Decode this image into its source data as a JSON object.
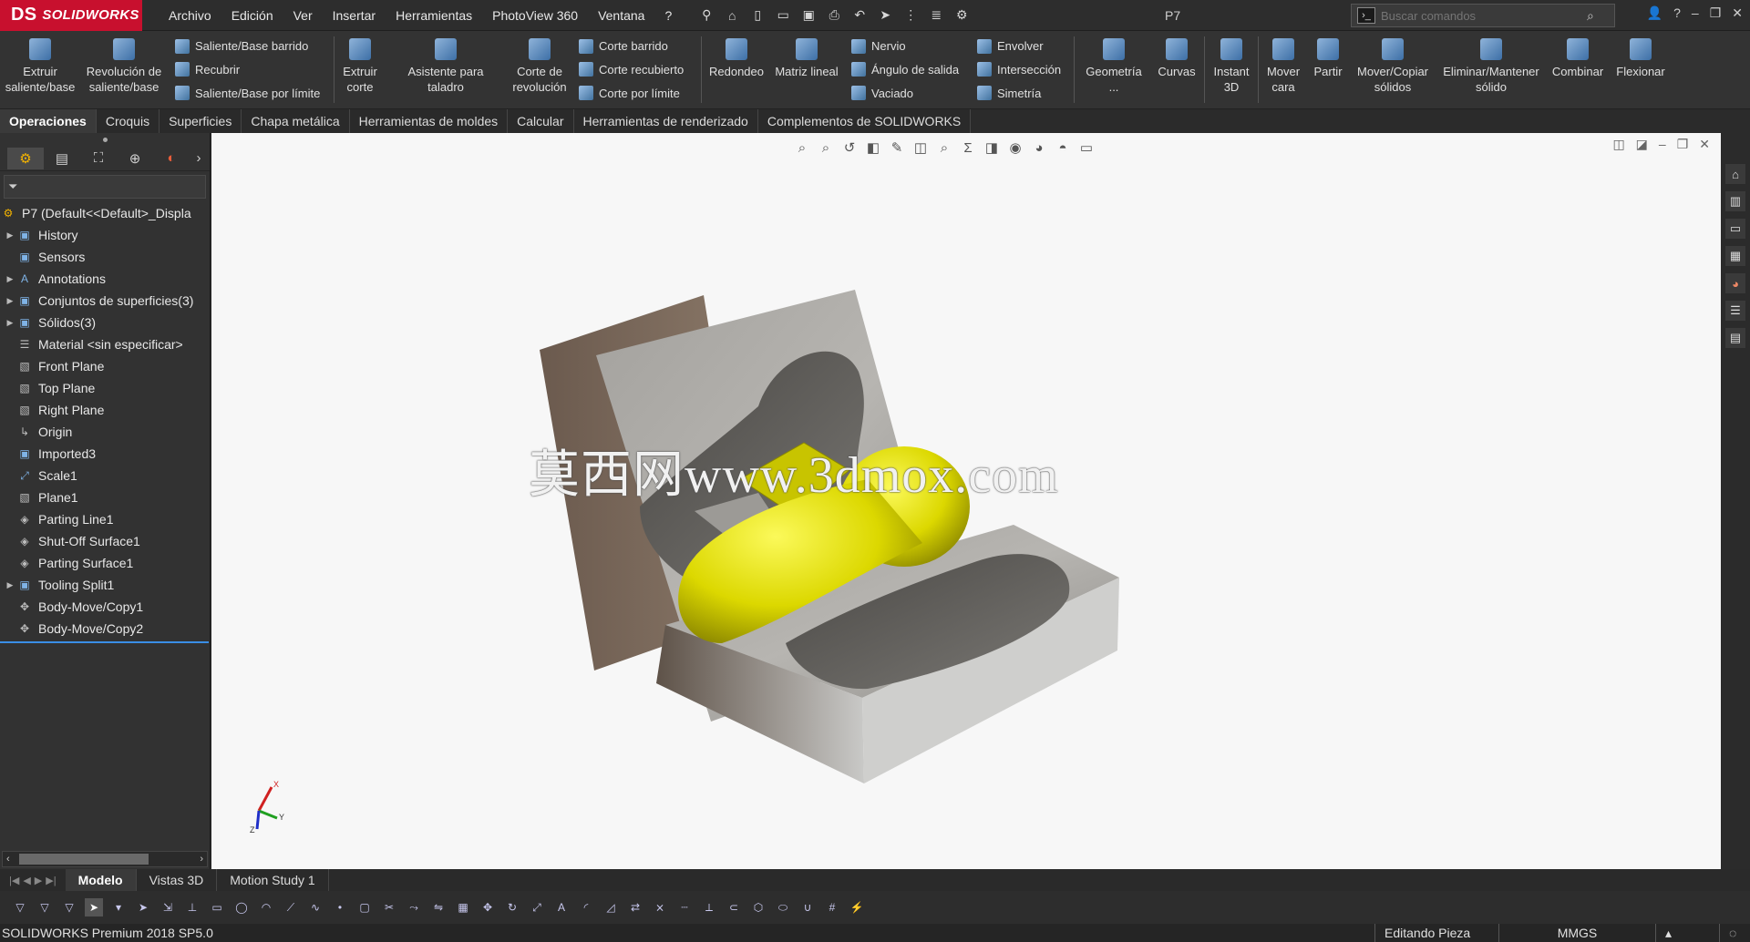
{
  "app": {
    "logo_text": "SOLIDWORKS",
    "logo_mark": "DS",
    "document_title": "P7",
    "menus": [
      "Archivo",
      "Edición",
      "Ver",
      "Insertar",
      "Herramientas",
      "PhotoView 360",
      "Ventana",
      "?"
    ],
    "search_placeholder": "Buscar comandos"
  },
  "ribbon": {
    "extrude": "Extruir saliente/base",
    "revolve": "Revolución de saliente/base",
    "sweep": "Saliente/Base barrido",
    "loft": "Recubrir",
    "boundary": "Saliente/Base por límite",
    "cut_extrude": "Extruir corte",
    "hole_wizard": "Asistente para taladro",
    "cut_revolve": "Corte de revolución",
    "cut_sweep": "Corte barrido",
    "cut_loft": "Corte recubierto",
    "cut_boundary": "Corte por límite",
    "fillet": "Redondeo",
    "linear_pattern": "Matriz lineal",
    "rib": "Nervio",
    "draft": "Ángulo de salida",
    "shell": "Vaciado",
    "wrap": "Envolver",
    "intersect": "Intersección",
    "mirror": "Simetría",
    "ref_geometry": "Geometría ...",
    "curves": "Curvas",
    "instant3d": "Instant 3D",
    "move_face": "Mover cara",
    "split": "Partir",
    "move_copy": "Mover/Copiar sólidos",
    "delete_keep": "Eliminar/Mantener sólido",
    "combine": "Combinar",
    "flex": "Flexionar"
  },
  "tabs": [
    "Operaciones",
    "Croquis",
    "Superficies",
    "Chapa metálica",
    "Herramientas de moldes",
    "Calcular",
    "Herramientas de renderizado",
    "Complementos de SOLIDWORKS"
  ],
  "tree": {
    "root": "P7  (Default<<Default>_Displa",
    "items": [
      {
        "label": "History",
        "expandable": true
      },
      {
        "label": "Sensors",
        "expandable": false
      },
      {
        "label": "Annotations",
        "expandable": true
      },
      {
        "label": "Conjuntos de superficies(3)",
        "expandable": true
      },
      {
        "label": "Sólidos(3)",
        "expandable": true
      },
      {
        "label": "Material <sin especificar>",
        "expandable": false
      },
      {
        "label": "Front Plane",
        "expandable": false
      },
      {
        "label": "Top Plane",
        "expandable": false
      },
      {
        "label": "Right Plane",
        "expandable": false
      },
      {
        "label": "Origin",
        "expandable": false
      },
      {
        "label": "Imported3",
        "expandable": false
      },
      {
        "label": "Scale1",
        "expandable": false
      },
      {
        "label": "Plane1",
        "expandable": false
      },
      {
        "label": "Parting Line1",
        "expandable": false
      },
      {
        "label": "Shut-Off Surface1",
        "expandable": false
      },
      {
        "label": "Parting Surface1",
        "expandable": false
      },
      {
        "label": "Tooling Split1",
        "expandable": true
      },
      {
        "label": "Body-Move/Copy1",
        "expandable": false
      },
      {
        "label": "Body-Move/Copy2",
        "expandable": false
      }
    ]
  },
  "viewport": {
    "watermark": "莫西网www.3dmox.com",
    "triad_x": "X",
    "triad_y": "Y",
    "triad_z": "Z"
  },
  "bottom_tabs": [
    "Modelo",
    "Vistas 3D",
    "Motion Study 1"
  ],
  "status": {
    "product": "SOLIDWORKS Premium 2018 SP5.0",
    "mode": "Editando Pieza",
    "units": "MMGS"
  },
  "colors": {
    "brand": "#c8102e",
    "part_yellow": "#e2e000",
    "mold_steel": "#8c8c8c",
    "mold_side": "#5a4e44"
  }
}
